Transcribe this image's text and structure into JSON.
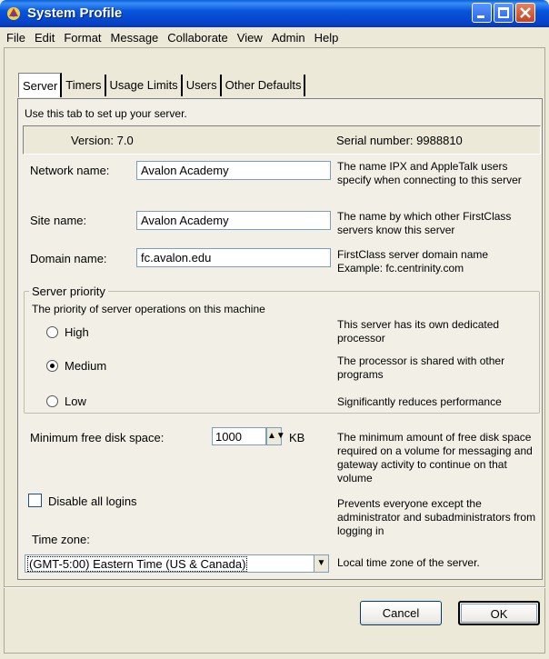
{
  "window": {
    "title": "System Profile",
    "app_icon": "firstclass-app-icon"
  },
  "menu": [
    "File",
    "Edit",
    "Format",
    "Message",
    "Collaborate",
    "View",
    "Admin",
    "Help"
  ],
  "tabs": [
    {
      "label": "Server",
      "active": true
    },
    {
      "label": "Timers",
      "active": false
    },
    {
      "label": "Usage Limits",
      "active": false
    },
    {
      "label": "Users",
      "active": false
    },
    {
      "label": "Other Defaults",
      "active": false
    }
  ],
  "server_tab": {
    "intro": "Use this tab to set up your server.",
    "version_label": "Version:",
    "version_value": "7.0",
    "serial_label": "Serial number:",
    "serial_value": "9988810",
    "network_name": {
      "label": "Network name:",
      "value": "Avalon Academy",
      "desc": "The name IPX and AppleTalk users specify when connecting to this server"
    },
    "site_name": {
      "label": "Site name:",
      "value": "Avalon Academy",
      "desc": "The name by which other FirstClass servers know this server"
    },
    "domain_name": {
      "label": "Domain name:",
      "value": "fc.avalon.edu",
      "desc_line1": "FirstClass server domain name",
      "desc_line2": "Example: fc.centrinity.com"
    },
    "priority": {
      "group_title": "Server priority",
      "subtitle": "The priority of server operations on this machine",
      "options": [
        {
          "label": "High",
          "checked": false,
          "desc": "This server has its own dedicated processor"
        },
        {
          "label": "Medium",
          "checked": true,
          "desc": "The processor is shared with other programs"
        },
        {
          "label": "Low",
          "checked": false,
          "desc": "Significantly reduces performance"
        }
      ]
    },
    "disk": {
      "label": "Minimum free disk space:",
      "value": "1000",
      "unit": "KB",
      "desc": "The minimum amount of free disk space required on a volume for messaging and gateway activity to continue on that volume"
    },
    "logins": {
      "label": "Disable all logins",
      "checked": false,
      "desc": "Prevents everyone except the administrator and subadministrators from logging in"
    },
    "timezone": {
      "label": "Time zone:",
      "value": "(GMT-5:00) Eastern Time (US & Canada)",
      "desc": "Local time zone of the server."
    }
  },
  "buttons": {
    "cancel": "Cancel",
    "ok": "OK"
  },
  "colors": {
    "titlebar": "#0855DD",
    "window_bg": "#ECE9D8",
    "panel_bg": "#F2F0E6"
  }
}
